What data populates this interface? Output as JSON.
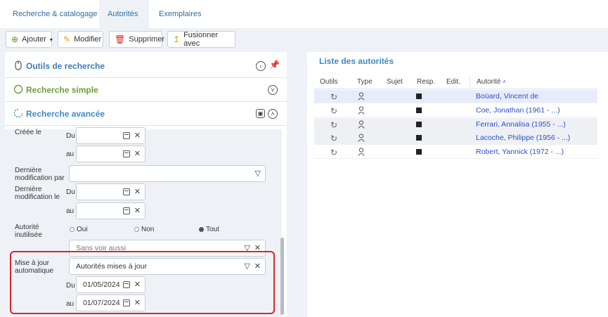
{
  "tabs": [
    {
      "label": "Recherche & catalogage",
      "active": false
    },
    {
      "label": "Autorités",
      "active": true
    },
    {
      "label": "Exemplaires",
      "active": false
    }
  ],
  "toolbar": {
    "add_label": "Ajouter",
    "edit_label": "Modifier",
    "delete_label": "Supprimer",
    "merge_label": "Fusionner avec"
  },
  "left": {
    "tools_title": "Outils de recherche",
    "simple_title": "Recherche simple",
    "advanced_title": "Recherche avancée",
    "created_label": "Créée le",
    "du": "Du",
    "au": "au",
    "modified_by_label": "Dernière modification par",
    "modified_on_label": "Dernière modification le",
    "unused_label": "Autorité inutilisée",
    "radio_oui": "Oui",
    "radio_non": "Non",
    "radio_tout": "Tout",
    "radio_selected": "Tout",
    "see_also_value": "Sans voir aussi",
    "auto_update_label": "Mise à jour automatique",
    "auto_update_value": "Autorités mises à jour",
    "auto_du_value": "01/05/2024",
    "auto_au_value": "01/07/2024"
  },
  "right": {
    "title": "Liste des autorités",
    "columns": [
      "Outils",
      "Type",
      "Sujet",
      "Resp.",
      "Edit.",
      "Autorité"
    ],
    "sort_marker": "˄",
    "rows": [
      {
        "authority": "Boüard, Vincent de"
      },
      {
        "authority": "Coe, Jonathan (1961 - ...)"
      },
      {
        "authority": "Ferrari, Annalisa (1955 - ...)"
      },
      {
        "authority": "Lacoche, Philippe (1956 - ...)"
      },
      {
        "authority": "Robert, Yannick (1972 - ...)"
      }
    ]
  },
  "colors": {
    "tools_title": "#3d7fb3",
    "simple_title": "#6aa03a",
    "advanced_title": "#3d8cc4",
    "highlight_border": "#d9262a",
    "link": "#2f4fcf"
  }
}
